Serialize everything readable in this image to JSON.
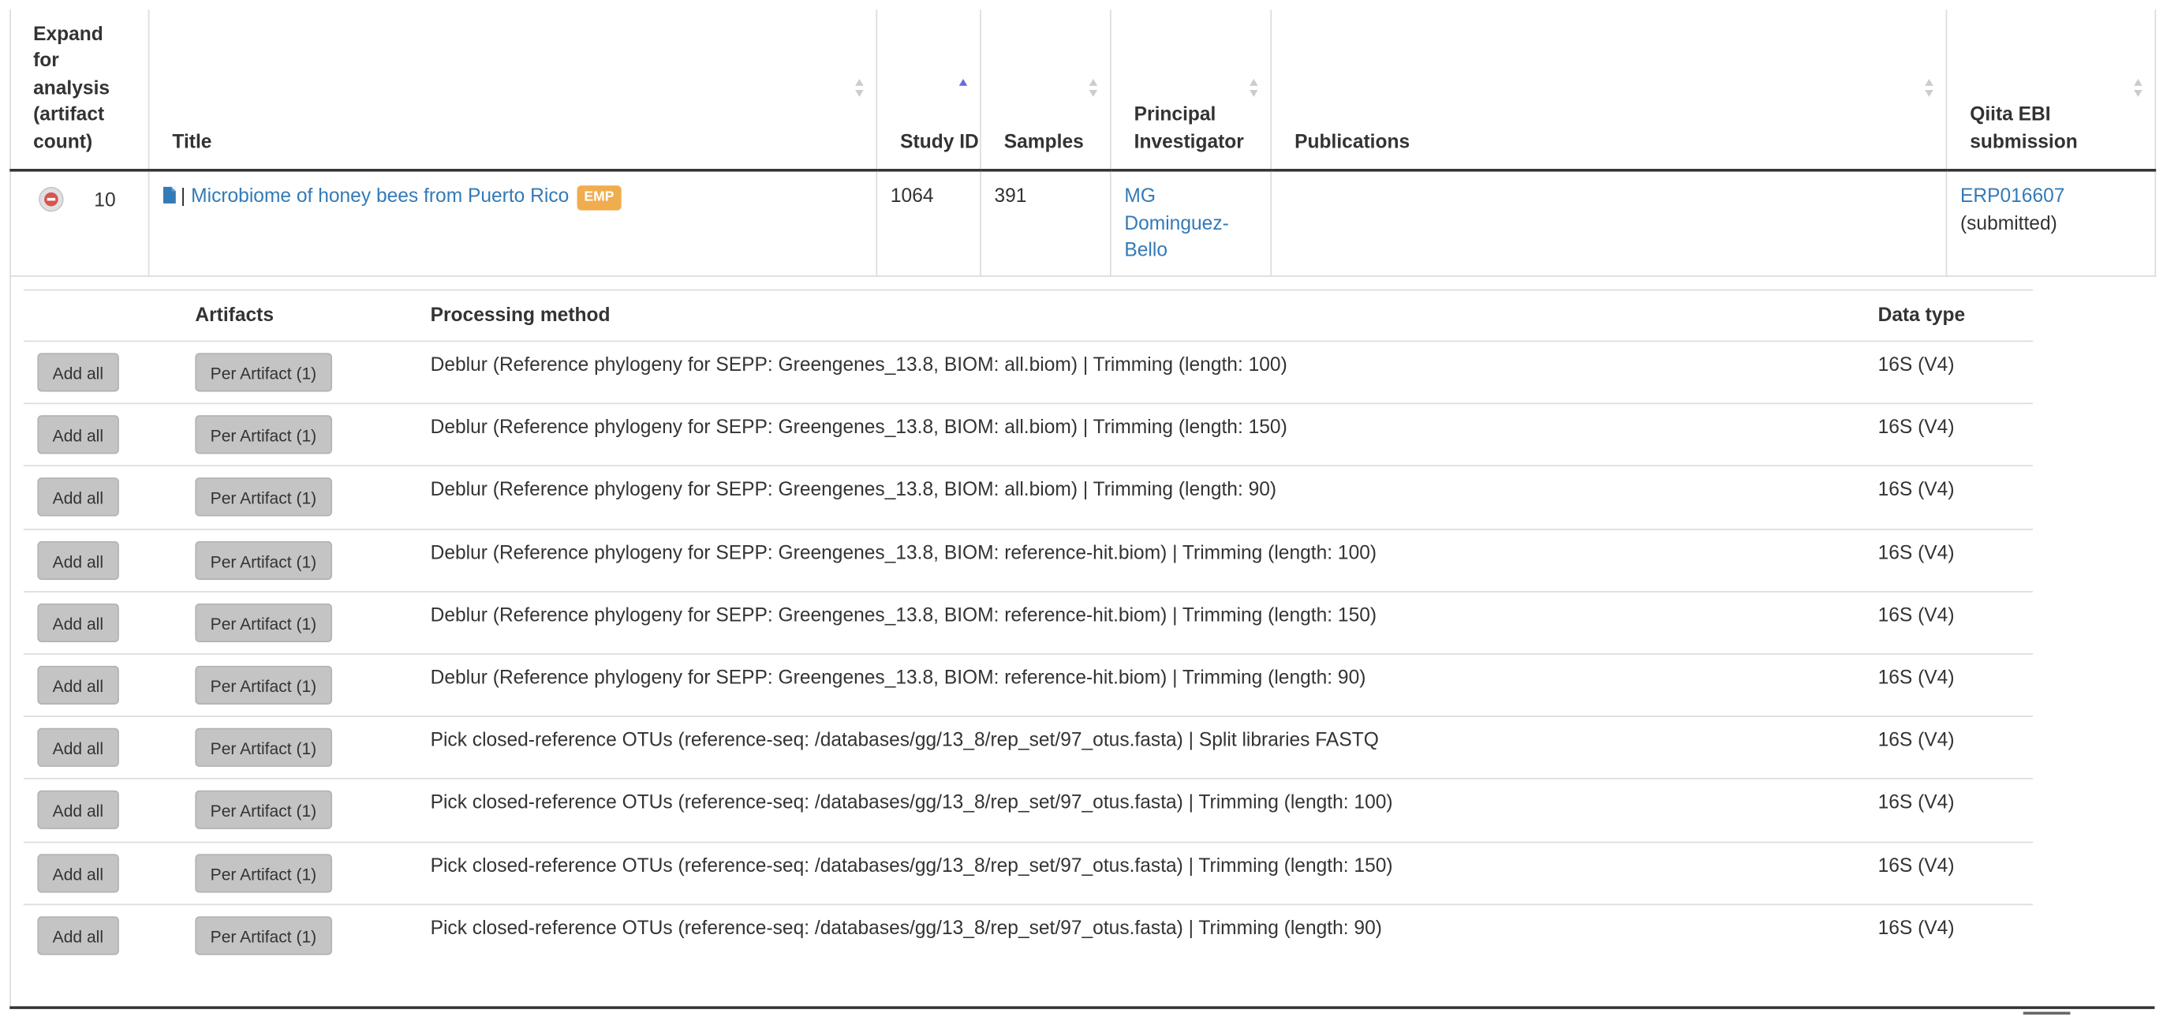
{
  "columns": [
    {
      "label": "Expand for analysis (artifact count)",
      "sortable": false
    },
    {
      "label": "Title",
      "sortable": true
    },
    {
      "label": "Study ID",
      "sortable": true,
      "sorted": "asc"
    },
    {
      "label": "Samples",
      "sortable": true
    },
    {
      "label": "Principal Investigator",
      "sortable": true
    },
    {
      "label": "Publications",
      "sortable": true
    },
    {
      "label": "Qiita EBI submission",
      "sortable": true
    }
  ],
  "study": {
    "artifact_count": "10",
    "title_separator": "|",
    "title": "Microbiome of honey bees from Puerto Rico",
    "badge": "EMP",
    "study_id": "1064",
    "samples": "391",
    "pi": "MG Dominguez-Bello",
    "publications": "",
    "ebi_accession": "ERP016607",
    "ebi_status": "(submitted)"
  },
  "artifacts_table": {
    "headers": {
      "add": "",
      "artifacts": "Artifacts",
      "method": "Processing method",
      "data_type": "Data type"
    },
    "add_all_label": "Add all",
    "rows": [
      {
        "per_artifact": "Per Artifact (1)",
        "method": "Deblur (Reference phylogeny for SEPP: Greengenes_13.8, BIOM: all.biom) | Trimming (length: 100)",
        "data_type": "16S (V4)"
      },
      {
        "per_artifact": "Per Artifact (1)",
        "method": "Deblur (Reference phylogeny for SEPP: Greengenes_13.8, BIOM: all.biom) | Trimming (length: 150)",
        "data_type": "16S (V4)"
      },
      {
        "per_artifact": "Per Artifact (1)",
        "method": "Deblur (Reference phylogeny for SEPP: Greengenes_13.8, BIOM: all.biom) | Trimming (length: 90)",
        "data_type": "16S (V4)"
      },
      {
        "per_artifact": "Per Artifact (1)",
        "method": "Deblur (Reference phylogeny for SEPP: Greengenes_13.8, BIOM: reference-hit.biom) | Trimming (length: 100)",
        "data_type": "16S (V4)"
      },
      {
        "per_artifact": "Per Artifact (1)",
        "method": "Deblur (Reference phylogeny for SEPP: Greengenes_13.8, BIOM: reference-hit.biom) | Trimming (length: 150)",
        "data_type": "16S (V4)"
      },
      {
        "per_artifact": "Per Artifact (1)",
        "method": "Deblur (Reference phylogeny for SEPP: Greengenes_13.8, BIOM: reference-hit.biom) | Trimming (length: 90)",
        "data_type": "16S (V4)"
      },
      {
        "per_artifact": "Per Artifact (1)",
        "method": "Pick closed-reference OTUs (reference-seq: /databases/gg/13_8/rep_set/97_otus.fasta) | Split libraries FASTQ",
        "data_type": "16S (V4)"
      },
      {
        "per_artifact": "Per Artifact (1)",
        "method": "Pick closed-reference OTUs (reference-seq: /databases/gg/13_8/rep_set/97_otus.fasta) | Trimming (length: 100)",
        "data_type": "16S (V4)"
      },
      {
        "per_artifact": "Per Artifact (1)",
        "method": "Pick closed-reference OTUs (reference-seq: /databases/gg/13_8/rep_set/97_otus.fasta) | Trimming (length: 150)",
        "data_type": "16S (V4)"
      },
      {
        "per_artifact": "Per Artifact (1)",
        "method": "Pick closed-reference OTUs (reference-seq: /databases/gg/13_8/rep_set/97_otus.fasta) | Trimming (length: 90)",
        "data_type": "16S (V4)"
      }
    ]
  },
  "colors": {
    "link": "#337ab7",
    "badge": "#f0ad4e",
    "remove": "#d9534f",
    "button": "#c4c4c4"
  },
  "icons": {
    "expand": "minus-circle-icon",
    "file": "file-icon",
    "sort": "sort-icon"
  }
}
